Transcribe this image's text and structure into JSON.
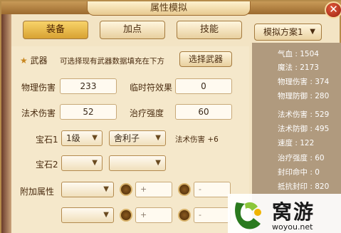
{
  "window": {
    "title": "属性模拟"
  },
  "tabs": [
    {
      "label": "装备",
      "active": true
    },
    {
      "label": "加点",
      "active": false
    },
    {
      "label": "技能",
      "active": false
    }
  ],
  "scheme_select": {
    "value": "模拟方案1"
  },
  "weapon": {
    "label": "武器",
    "hint": "可选择现有武器数据填充在下方",
    "select_button": "选择武器"
  },
  "fields": {
    "physical_damage": {
      "label": "物理伤害",
      "value": "233"
    },
    "temp_effect": {
      "label": "临时符效果",
      "value": "0"
    },
    "magic_damage": {
      "label": "法术伤害",
      "value": "52"
    },
    "heal_strength": {
      "label": "治疗强度",
      "value": "60"
    }
  },
  "gems": [
    {
      "label": "宝石1",
      "level": "1级",
      "type": "舍利子",
      "effect": "法术伤害 +6"
    },
    {
      "label": "宝石2",
      "level": "",
      "type": "",
      "effect": ""
    }
  ],
  "extra_attr": {
    "label": "附加属性",
    "rows": [
      {
        "plus": "+",
        "minus": "-"
      },
      {
        "plus": "+",
        "minus": "-"
      }
    ]
  },
  "stats": [
    {
      "name": "气血",
      "value": "1504"
    },
    {
      "name": "魔法",
      "value": "2173"
    },
    {
      "name": "物理伤害",
      "value": "374"
    },
    {
      "name": "物理防御",
      "value": "280"
    },
    {
      "name": "法术伤害",
      "value": "529"
    },
    {
      "name": "法术防御",
      "value": "495"
    },
    {
      "name": "速度",
      "value": "122"
    },
    {
      "name": "治疗强度",
      "value": "60"
    },
    {
      "name": "封印命中",
      "value": "0"
    },
    {
      "name": "抵抗封印",
      "value": "820"
    }
  ],
  "watermark": {
    "brand": "窝游",
    "url": "woyou.net"
  },
  "colors": {
    "accent_tab": "#f8d36a",
    "close": "#c0301a"
  }
}
